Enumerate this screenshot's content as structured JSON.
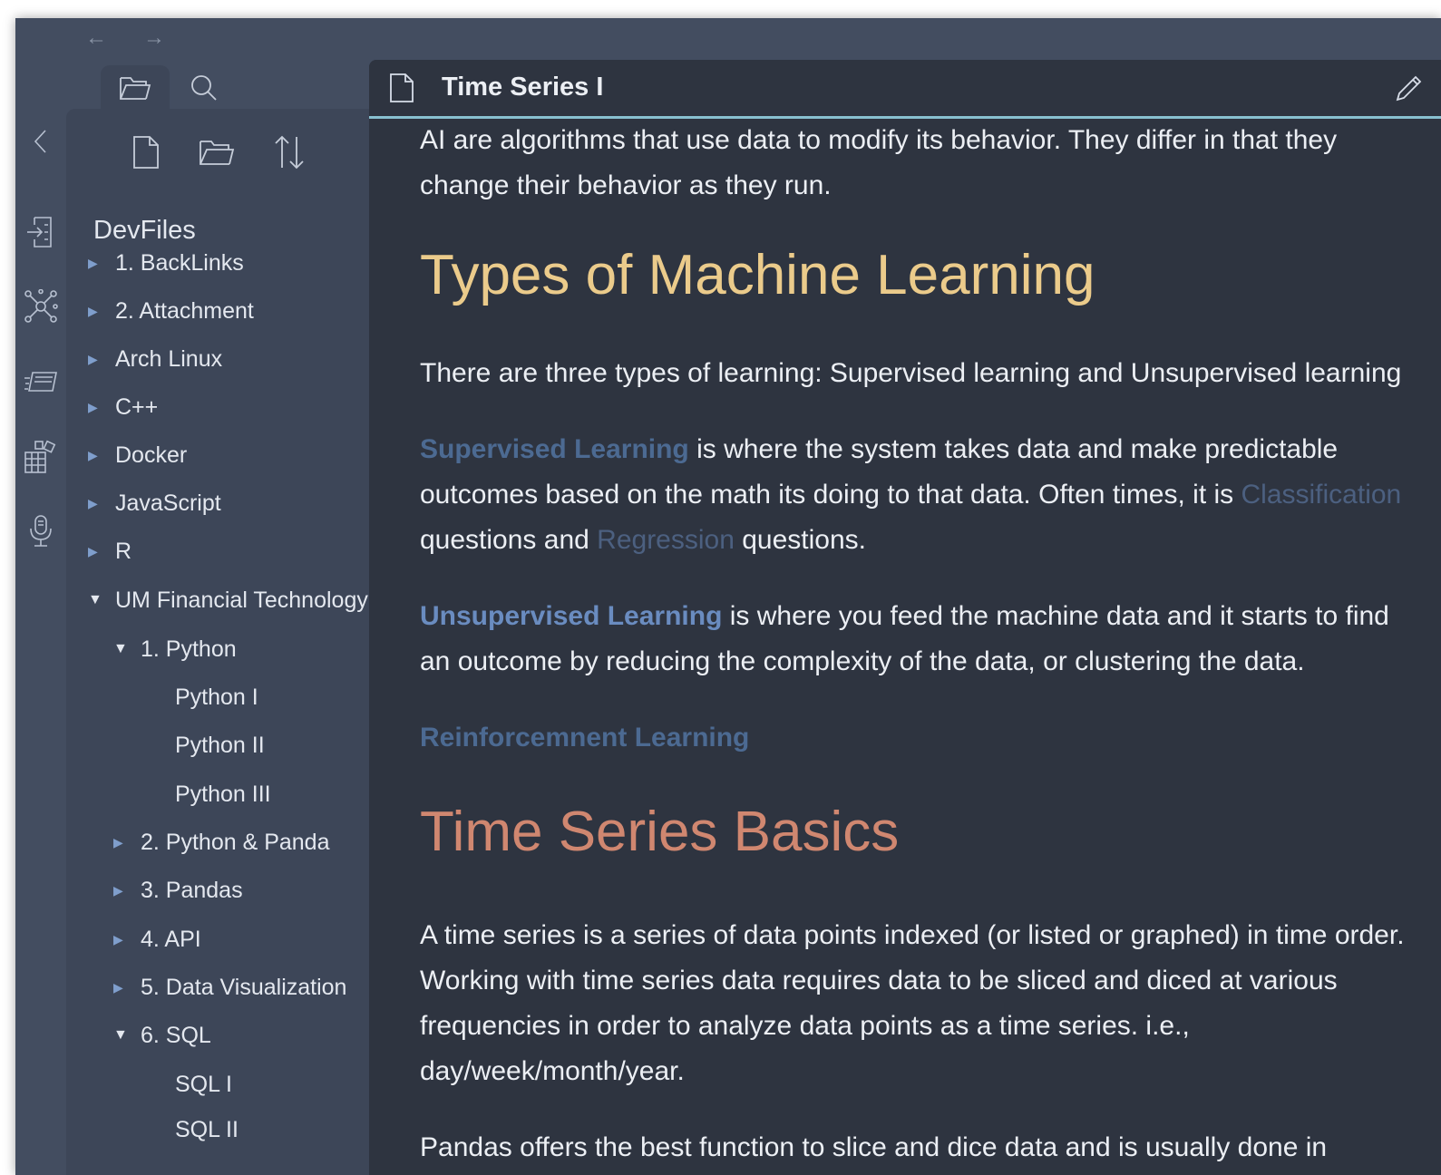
{
  "nav": {
    "back": "←",
    "forward": "→"
  },
  "ribbon": {
    "collapse": "chevron-left-icon",
    "icons": [
      "document-export-icon",
      "graph-view-icon",
      "slides-icon",
      "plugins-grid-icon",
      "microphone-icon"
    ]
  },
  "sidebar": {
    "tabs": [
      "folder-icon",
      "search-icon"
    ],
    "actions": [
      "new-note-icon",
      "new-folder-icon",
      "sort-icon"
    ],
    "vault_name": "DevFiles",
    "tree": [
      {
        "label": "1. BackLinks"
      },
      {
        "label": "2. Attachment"
      },
      {
        "label": "Arch Linux"
      },
      {
        "label": "C++"
      },
      {
        "label": "Docker"
      },
      {
        "label": "JavaScript"
      },
      {
        "label": "R"
      },
      {
        "label": "UM Financial Technology"
      },
      {
        "label": "1. Python"
      },
      {
        "label": "Python I"
      },
      {
        "label": "Python II"
      },
      {
        "label": "Python III"
      },
      {
        "label": "2. Python & Panda"
      },
      {
        "label": "3. Pandas"
      },
      {
        "label": "4. API"
      },
      {
        "label": "5. Data Visualization"
      },
      {
        "label": "6. SQL"
      },
      {
        "label": "SQL I"
      },
      {
        "label": "SQL II"
      }
    ]
  },
  "tab": {
    "title": "Time Series I"
  },
  "doc": {
    "p_intro_1": "AI are algorithms that use data to modify its behavior. They differ in that they",
    "p_intro_2": "change their behavior as they run.",
    "h_types": "Types of Machine Learning",
    "p_types": "There are three types of learning: Supervised learning and Unsupervised learning",
    "sup_link": "Supervised Learning",
    "sup_1_rest": " is where the system takes data and make predictable",
    "sup_2": "outcomes based on the math its doing to that data. Often times, it is ",
    "classi_link": "Classification",
    "sup_3_pre": "questions and ",
    "regression_link": "Regression",
    "sup_3_post": " questions.",
    "unsup_link": "Unsupervised Learning",
    "unsup_1_rest": " is where you feed the machine data and it starts to find",
    "unsup_2": "an outcome by reducing the complexity of the data, or clustering the data.",
    "reinf_link": "Reinforcemnent Learning",
    "h_ts": "Time Series Basics",
    "ts_1": "A time series is a series of data points indexed (or listed or graphed) in time order.",
    "ts_2": "Working with time series data requires data to be sliced and diced at various",
    "ts_3": "frequencies in order to analyze data points as a time series. i.e.,",
    "ts_4": "day/week/month/year.",
    "pandas_1": "Pandas offers the best function to slice and dice data and is usually done in"
  }
}
